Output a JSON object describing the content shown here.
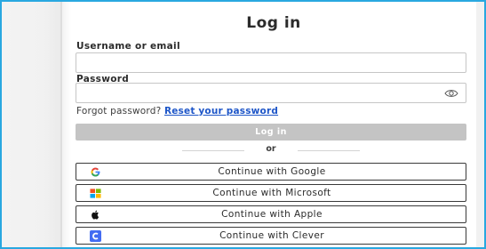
{
  "title": "Log in",
  "username": {
    "label": "Username or email",
    "value": "",
    "placeholder": ""
  },
  "password": {
    "label": "Password",
    "value": "",
    "placeholder": ""
  },
  "forgot": {
    "text": "Forgot password?",
    "link": "Reset your password"
  },
  "login_button": "Log in",
  "divider": "or",
  "sso": [
    {
      "label": "Continue with Google",
      "icon": "google-icon"
    },
    {
      "label": "Continue with Microsoft",
      "icon": "microsoft-icon"
    },
    {
      "label": "Continue with Apple",
      "icon": "apple-icon"
    },
    {
      "label": "Continue with Clever",
      "icon": "clever-icon"
    }
  ],
  "colors": {
    "frame_border": "#29a8e0",
    "link": "#1e56c8",
    "button_disabled": "#c4c4c4",
    "clever": "#436cf2"
  }
}
